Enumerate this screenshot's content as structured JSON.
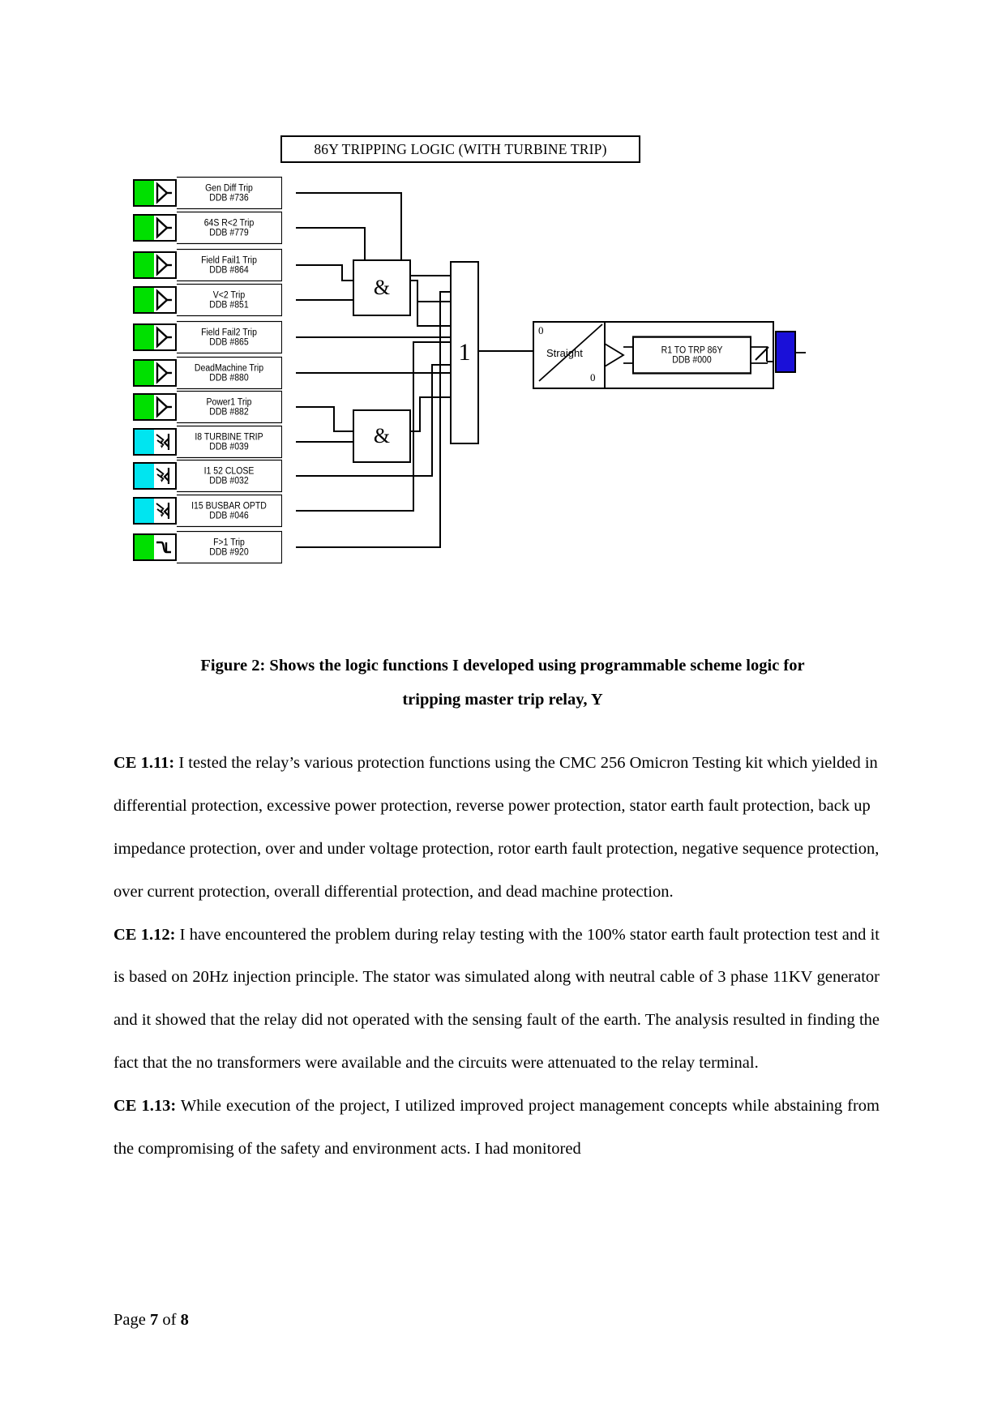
{
  "figure": {
    "title": "86Y TRIPPING LOGIC (WITH TURBINE TRIP)",
    "inputs": [
      {
        "name": "Gen Diff Trip",
        "ddb": "DDB #736",
        "color": "#00e000",
        "icon": "buffer-gate-icon"
      },
      {
        "name": "64S R<2 Trip",
        "ddb": "DDB #779",
        "color": "#00e000",
        "icon": "buffer-gate-icon"
      },
      {
        "name": "Field Fail1 Trip",
        "ddb": "DDB #864",
        "color": "#00e000",
        "icon": "buffer-gate-icon"
      },
      {
        "name": "V<2 Trip",
        "ddb": "DDB #851",
        "color": "#00e000",
        "icon": "buffer-gate-icon"
      },
      {
        "name": "Field Fail2 Trip",
        "ddb": "DDB #865",
        "color": "#00e000",
        "icon": "buffer-gate-icon"
      },
      {
        "name": "DeadMachine Trip",
        "ddb": "DDB #880",
        "color": "#00e000",
        "icon": "buffer-gate-icon"
      },
      {
        "name": "Power1 Trip",
        "ddb": "DDB #882",
        "color": "#00e000",
        "icon": "buffer-gate-icon"
      },
      {
        "name": "I8 TURBINE TRIP",
        "ddb": "DDB #039",
        "color": "#00e5f0",
        "icon": "opto-input-icon"
      },
      {
        "name": "I1 52 CLOSE",
        "ddb": "DDB #032",
        "color": "#00e5f0",
        "icon": "opto-input-icon"
      },
      {
        "name": "I15 BUSBAR OPTD",
        "ddb": "DDB #046",
        "color": "#00e5f0",
        "icon": "opto-input-icon"
      },
      {
        "name": "F>1 Trip",
        "ddb": "DDB #920",
        "color": "#00e000",
        "icon": "timer-gate-icon"
      }
    ],
    "gates": {
      "and_upper": "&",
      "and_lower": "&",
      "or_main": "1"
    },
    "output": {
      "switch_top_value": "0",
      "switch_bottom_value": "0",
      "switch_mode": "Straight",
      "relay_name": "R1 TO TRP 86Y",
      "relay_ddb": "DDB #000",
      "chip_color": "#1a10d8"
    }
  },
  "caption": {
    "line1": "Figure 2: Shows the logic functions I developed using programmable scheme logic for",
    "line2": "tripping master trip relay, Y"
  },
  "body": {
    "ce111_label": "CE 1.11:",
    "ce111_text": " I tested the relay’s various protection functions using the CMC 256 Omicron Testing kit which yielded in differential protection, excessive power protection, reverse power protection, stator earth fault protection, back up impedance protection, over and under voltage protection, rotor earth fault protection, negative sequence protection, over current protection, overall differential protection, and dead machine protection.",
    "ce112_label": "CE 1.12:",
    "ce112_text": " I have encountered the problem during relay testing with the 100% stator earth fault protection test and it is based on 20Hz injection principle. The stator was simulated along with neutral cable of 3 phase 11KV generator and it showed that the relay did not operated with the sensing fault of the earth. The analysis resulted in finding the fact that the no transformers were available and the circuits were attenuated to the relay terminal.",
    "ce113_label": "CE 1.13:",
    "ce113_text": " While execution of the project, I utilized improved project management concepts while abstaining from the compromising of the safety and environment acts. I had monitored"
  },
  "footer": {
    "prefix": "Page ",
    "current": "7",
    "middle": " of ",
    "total": "8"
  }
}
